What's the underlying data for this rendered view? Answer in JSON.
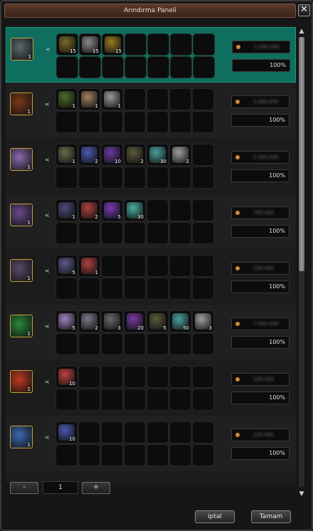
{
  "window": {
    "title": "Arındırma Paneli",
    "close_label": "✕"
  },
  "rows": [
    {
      "result_color": "#5a6a6a",
      "result_count": "1",
      "price": "1.000.000",
      "rate": "100%",
      "selected": true,
      "ingredients": [
        {
          "count": "15",
          "color": "#7a6a2a"
        },
        {
          "count": "15",
          "color": "#8a8a8a"
        },
        {
          "count": "15",
          "color": "#9a7a20"
        }
      ]
    },
    {
      "result_color": "#7a3a1a",
      "result_count": "1",
      "price": "5.000.000",
      "rate": "100%",
      "ingredients": [
        {
          "count": "1",
          "color": "#4a6a2a"
        },
        {
          "count": "1",
          "color": "#a08060"
        },
        {
          "count": "1",
          "color": "#9a9a9a"
        }
      ]
    },
    {
      "result_color": "#8a6ab0",
      "result_count": "1",
      "price": "1.500.000",
      "rate": "100%",
      "ingredients": [
        {
          "count": "1",
          "color": "#6a6a4a"
        },
        {
          "count": "2",
          "color": "#4a5ab0"
        },
        {
          "count": "10",
          "color": "#6a3aa0"
        },
        {
          "count": "2",
          "color": "#5a5a3a"
        },
        {
          "count": "30",
          "color": "#4aa0a0"
        },
        {
          "count": "2",
          "color": "#a0a0a0"
        }
      ]
    },
    {
      "result_color": "#6a4a8a",
      "result_count": "1",
      "price": "750.000",
      "rate": "100%",
      "ingredients": [
        {
          "count": "1",
          "color": "#4a4a7a"
        },
        {
          "count": "2",
          "color": "#b04040"
        },
        {
          "count": "5",
          "color": "#7a3ab0"
        },
        {
          "count": "30",
          "color": "#4ab0a0"
        }
      ]
    },
    {
      "result_color": "#5a4a6a",
      "result_count": "1",
      "price": "750.000",
      "rate": "100%",
      "ingredients": [
        {
          "count": "5",
          "color": "#5a5a8a"
        },
        {
          "count": "1",
          "color": "#b04040"
        }
      ]
    },
    {
      "result_color": "#2a8a3a",
      "result_count": "1",
      "price": "7.000.000",
      "rate": "100%",
      "ingredients": [
        {
          "count": "5",
          "color": "#a080c0"
        },
        {
          "count": "2",
          "color": "#7a7a8a"
        },
        {
          "count": "3",
          "color": "#6a6a6a"
        },
        {
          "count": "20",
          "color": "#7a3aa0"
        },
        {
          "count": "5",
          "color": "#5a5a3a"
        },
        {
          "count": "50",
          "color": "#4aa0a0"
        },
        {
          "count": "3",
          "color": "#a0a0a0"
        }
      ]
    },
    {
      "result_color": "#c03a20",
      "result_count": "1",
      "price": "100.000",
      "rate": "100%",
      "ingredients": [
        {
          "count": "10",
          "color": "#c04040"
        }
      ]
    },
    {
      "result_color": "#3a6ab0",
      "result_count": "1",
      "price": "100.000",
      "rate": "100%",
      "ingredients": [
        {
          "count": "10",
          "color": "#4a5ab0"
        }
      ]
    }
  ],
  "arrow_glyph": "<",
  "quantity": {
    "minus": "-",
    "value": "1",
    "plus": "+"
  },
  "scroll": {
    "up": "▲",
    "down": "▼",
    "position_fraction": 0.0,
    "visible_fraction": 0.52
  },
  "buttons": {
    "cancel": "iptal",
    "ok": "Tamam"
  }
}
